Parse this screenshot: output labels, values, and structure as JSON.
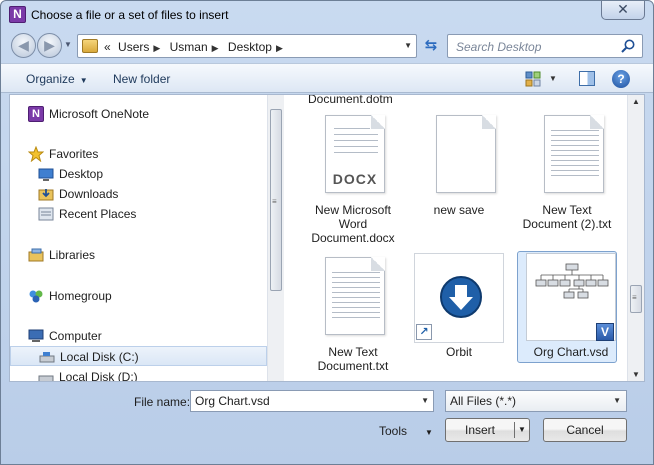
{
  "window": {
    "title": "Choose a file or a set of files to insert",
    "close_glyph": "✕",
    "app_icon_letter": "N"
  },
  "address_bar": {
    "prefix": "«",
    "crumbs": [
      "Users",
      "Usman",
      "Desktop"
    ],
    "search_placeholder": "Search Desktop"
  },
  "toolbar": {
    "organize_label": "Organize",
    "new_folder_label": "New folder",
    "help_glyph": "?"
  },
  "nav_pane": {
    "items": [
      {
        "label": "Microsoft OneNote",
        "icon": "onenote-icon"
      },
      {
        "label": "Favorites",
        "icon": "star-icon"
      },
      {
        "label": "Desktop",
        "icon": "desktop-icon"
      },
      {
        "label": "Downloads",
        "icon": "downloads-folder-icon"
      },
      {
        "label": "Recent Places",
        "icon": "recent-places-icon"
      },
      {
        "label": "Libraries",
        "icon": "libraries-icon"
      },
      {
        "label": "Homegroup",
        "icon": "homegroup-icon"
      },
      {
        "label": "Computer",
        "icon": "computer-icon"
      },
      {
        "label": "Local Disk (C:)",
        "icon": "drive-icon"
      },
      {
        "label": "Local Disk (D:)",
        "icon": "drive-icon"
      }
    ]
  },
  "files": {
    "partial_label": "Document.dotm",
    "items": [
      {
        "name_lines": [
          "New Microsoft",
          "Word",
          "Document.docx"
        ],
        "badge": "DOCX",
        "icon": "docx-file-icon"
      },
      {
        "name_lines": [
          "new save"
        ],
        "icon": "blank-file-icon"
      },
      {
        "name_lines": [
          "New Text",
          "Document (2).txt"
        ],
        "icon": "text-file-icon"
      },
      {
        "name_lines": [
          "New Text",
          "Document.txt"
        ],
        "icon": "text-file-icon"
      },
      {
        "name_lines": [
          "Orbit"
        ],
        "icon": "orbit-shortcut-icon"
      },
      {
        "name_lines": [
          "Org Chart.vsd"
        ],
        "icon": "visio-file-icon",
        "selected": true
      }
    ]
  },
  "form": {
    "file_name_label": "File name:",
    "file_name_value": "Org Chart.vsd",
    "filter_value": "All Files (*.*)",
    "tools_label": "Tools",
    "insert_label": "Insert",
    "cancel_label": "Cancel"
  }
}
